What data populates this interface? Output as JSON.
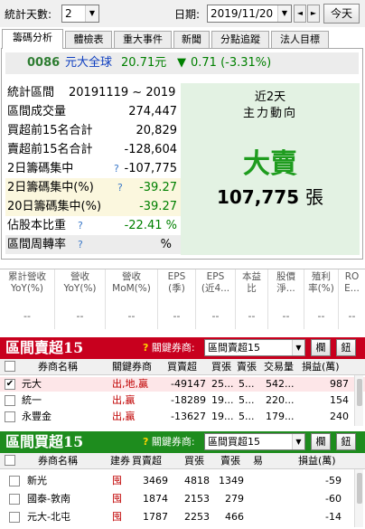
{
  "toolbar": {
    "days_label": "統計天數:",
    "days_value": "2",
    "date_label": "日期:",
    "date_value": "2019/11/20",
    "prev_arrow": "◄",
    "next_arrow": "►",
    "today_button": "今天"
  },
  "tabs": [
    "籌碼分析",
    "體檢表",
    "重大事件",
    "新聞",
    "分點追蹤",
    "法人目標"
  ],
  "stock": {
    "code": "0086",
    "name": "元大全球",
    "price": "20.71元",
    "arrow": "▼",
    "change": "0.71 (-3.31%)"
  },
  "stats": [
    {
      "label": "統計區間",
      "value": "20191119 ~ 2019"
    },
    {
      "label": "區間成交量",
      "value": "274,447"
    },
    {
      "label": "買超前15名合計",
      "value": "20,829"
    },
    {
      "label": "賣超前15名合計",
      "value": "-128,604"
    },
    {
      "label": "2日籌碼集中",
      "value": "-107,775",
      "help": "?"
    },
    {
      "label": "2日籌碼集中(%)",
      "value": "-39.27",
      "help": "?"
    },
    {
      "label": "20日籌碼集中(%)",
      "value": "-39.27"
    },
    {
      "label": "佔股本比重",
      "value": "-22.41 %",
      "help": "?"
    },
    {
      "label": "區間周轉率",
      "value": "%",
      "help": "?"
    }
  ],
  "summary": {
    "title1": "近2天",
    "title2": "主力動向",
    "verdict": "大賣",
    "amount": "107,775",
    "unit": "張"
  },
  "metrics": {
    "headers": [
      [
        "累計營收",
        "YoY(%)"
      ],
      [
        "營收",
        "YoY(%)"
      ],
      [
        "營收",
        "MoM(%)"
      ],
      [
        "EPS",
        "(季)"
      ],
      [
        "EPS",
        "(近4..."
      ],
      [
        "本益",
        "比"
      ],
      [
        "股價",
        "淨..."
      ],
      [
        "殖利",
        "率(%)"
      ],
      [
        "RO",
        "E..."
      ]
    ],
    "values": [
      "--",
      "--",
      "--",
      "--",
      "--",
      "--",
      "--",
      "--",
      "--"
    ]
  },
  "sell_section": {
    "title": "區間賣超15",
    "key_label": "關鍵券商:",
    "combo_value": "區間賣超15",
    "btn1": "欄",
    "btn2": "鈕",
    "help": "?",
    "columns": [
      "券商名稱",
      "關鍵券商",
      "買賣超",
      "買張",
      "賣張",
      "交易量",
      "損益(萬)"
    ],
    "rows": [
      {
        "checked": "✔",
        "broker": "元大",
        "tags": [
          "出",
          "地",
          "贏"
        ],
        "net": "-49147",
        "buy": "25...",
        "sell": "5...",
        "vol": "542...",
        "pnl": "987"
      },
      {
        "checked": "",
        "broker": "統一",
        "tags": [
          "出",
          "贏"
        ],
        "net": "-18289",
        "buy": "19...",
        "sell": "5...",
        "vol": "220...",
        "pnl": "154"
      },
      {
        "checked": "",
        "broker": "永豐金",
        "tags": [
          "出",
          "贏"
        ],
        "net": "-13627",
        "buy": "19...",
        "sell": "5...",
        "vol": "179...",
        "pnl": "240"
      }
    ]
  },
  "buy_section": {
    "title": "區間買超15",
    "key_label": "關鍵券商:",
    "combo_value": "區間買超15",
    "btn1": "欄",
    "btn2": "鈕",
    "help": "?",
    "columns": [
      "券商名稱",
      "建券",
      "買賣超",
      "買張",
      "賣張",
      "易",
      "損益(萬)"
    ],
    "rows": [
      {
        "broker": "新光",
        "tag": "囤",
        "net": "3469",
        "buy": "4818",
        "sell": "1349",
        "pnl": "-59"
      },
      {
        "broker": "國泰-敦南",
        "tag": "囤",
        "net": "1874",
        "sell_label": "",
        "buy": "2153",
        "sell": "279",
        "pnl": "-60"
      },
      {
        "broker": "元大-北屯",
        "tag": "囤",
        "net": "1787",
        "buy": "2253",
        "sell": "466",
        "pnl": "-14"
      }
    ]
  },
  "colors": {
    "sell_header": "#c8001e",
    "buy_header": "#1e8c1e",
    "green_panel": "#e3f2e3",
    "stock_code": "#2e7d32",
    "stock_blue": "#1040c0",
    "down_green": "#008000",
    "tag_red": "#c00000"
  }
}
